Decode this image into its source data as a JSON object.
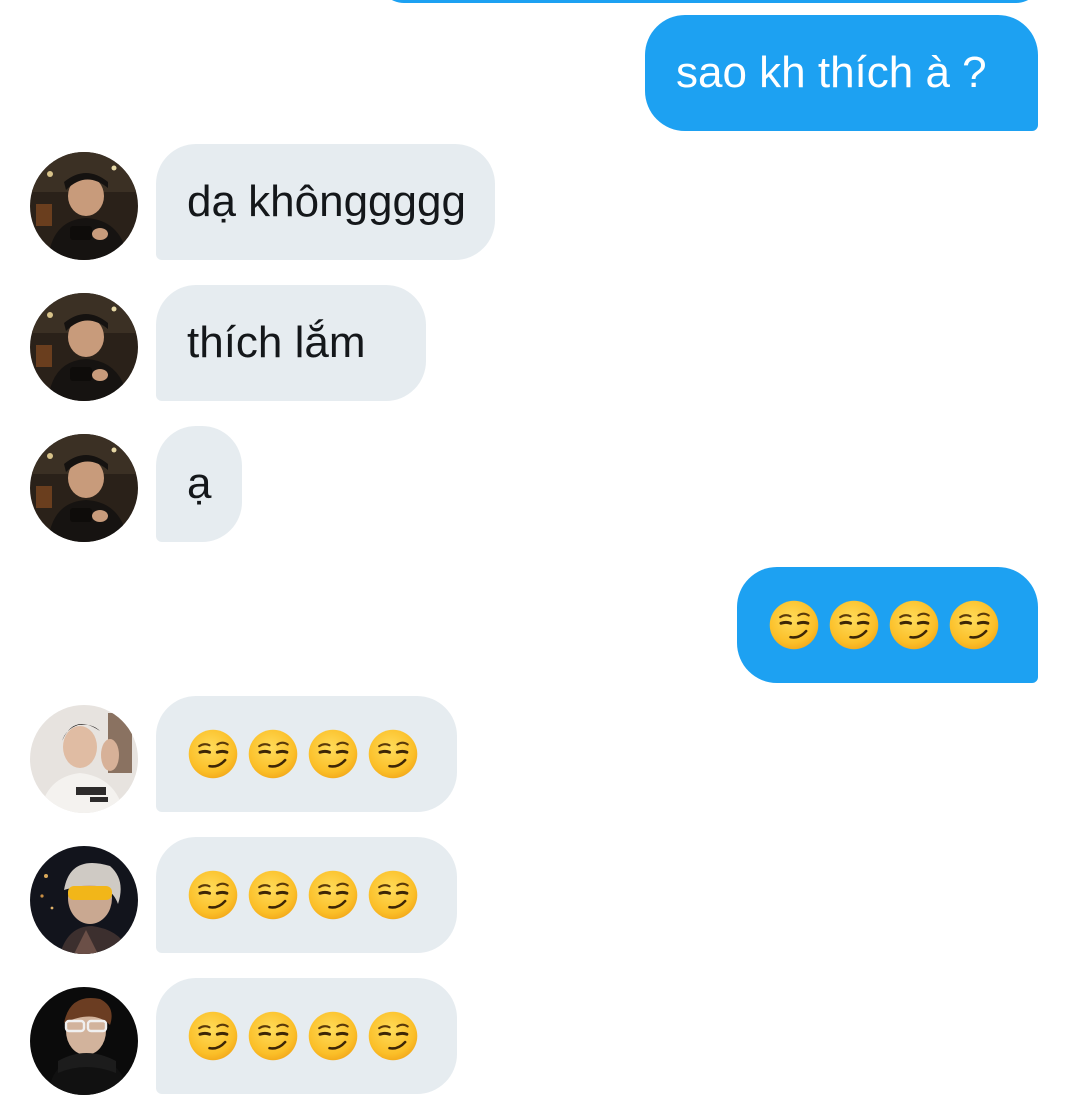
{
  "colors": {
    "outgoing_bubble": "#1da1f2",
    "incoming_bubble": "#e6ecf0",
    "outgoing_text": "#ffffff",
    "incoming_text": "#14171a"
  },
  "messages": [
    {
      "direction": "outgoing",
      "text": "sao kh thích à ?"
    },
    {
      "direction": "incoming",
      "sender_avatar": "user-photo-avatar",
      "text": "dạ khônggggg"
    },
    {
      "direction": "incoming",
      "sender_avatar": "user-photo-avatar",
      "text": "thích lắm"
    },
    {
      "direction": "incoming",
      "sender_avatar": "user-photo-avatar",
      "text": "ạ"
    },
    {
      "direction": "outgoing",
      "emoji": "smirking-face",
      "emoji_count": 4
    },
    {
      "direction": "incoming",
      "sender_avatar": "user-photo-avatar",
      "emoji": "smirking-face",
      "emoji_count": 4
    },
    {
      "direction": "incoming",
      "sender_avatar": "user-photo-avatar",
      "emoji": "smirking-face",
      "emoji_count": 4
    },
    {
      "direction": "incoming",
      "sender_avatar": "user-photo-avatar",
      "emoji": "smirking-face",
      "emoji_count": 4
    }
  ]
}
